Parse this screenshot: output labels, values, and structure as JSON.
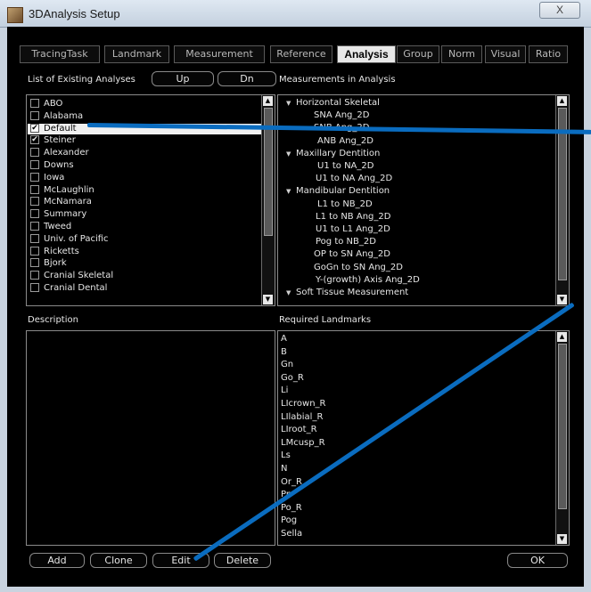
{
  "window": {
    "title": "3DAnalysis Setup",
    "close_glyph": "X"
  },
  "tabs": [
    "TracingTask",
    "Landmark",
    "Measurement",
    "Reference",
    "Analysis",
    "Group",
    "Norm",
    "Visual",
    "Ratio"
  ],
  "active_tab": "Analysis",
  "analyses": {
    "label": "List of Existing Analyses",
    "up_label": "Up",
    "dn_label": "Dn",
    "items": [
      {
        "name": "ABO",
        "checked": false
      },
      {
        "name": "Alabama",
        "checked": false
      },
      {
        "name": "Default",
        "checked": true,
        "selected": true
      },
      {
        "name": "Steiner",
        "checked": true
      },
      {
        "name": "Alexander",
        "checked": false
      },
      {
        "name": "Downs",
        "checked": false
      },
      {
        "name": "Iowa",
        "checked": false
      },
      {
        "name": "McLaughlin",
        "checked": false
      },
      {
        "name": "McNamara",
        "checked": false
      },
      {
        "name": "Summary",
        "checked": false
      },
      {
        "name": "Tweed",
        "checked": false
      },
      {
        "name": "Univ. of Pacific",
        "checked": false
      },
      {
        "name": "Ricketts",
        "checked": false
      },
      {
        "name": "Bjork",
        "checked": false
      },
      {
        "name": "Cranial Skeletal",
        "checked": false
      },
      {
        "name": "Cranial Dental",
        "checked": false
      }
    ]
  },
  "measurements": {
    "label": "Measurements in Analysis",
    "groups": [
      {
        "name": "Horizontal Skeletal",
        "items": [
          "SNA Ang_2D",
          "SNB Ang_2D",
          "ANB Ang_2D"
        ]
      },
      {
        "name": "Maxillary Dentition",
        "items": [
          "U1 to NA_2D",
          "U1 to NA Ang_2D"
        ]
      },
      {
        "name": "Mandibular Dentition",
        "items": [
          "L1 to NB_2D",
          "L1 to NB Ang_2D",
          "U1 to L1 Ang_2D",
          "Pog to NB_2D",
          "OP to SN Ang_2D",
          "GoGn to SN Ang_2D",
          "Y-(growth) Axis Ang_2D"
        ]
      },
      {
        "name": "Soft Tissue Measurement",
        "items": []
      }
    ]
  },
  "description": {
    "label": "Description",
    "text": ""
  },
  "landmarks": {
    "label": "Required Landmarks",
    "items": [
      "A",
      "B",
      "Gn",
      "Go_R",
      "Li",
      "LIcrown_R",
      "LIlabial_R",
      "LIroot_R",
      "LMcusp_R",
      "Ls",
      "N",
      "Or_R",
      "Pn",
      "Po_R",
      "Pog",
      "Sella"
    ]
  },
  "buttons": {
    "add": "Add",
    "clone": "Clone",
    "edit": "Edit",
    "delete": "Delete",
    "ok": "OK"
  },
  "colors": {
    "annotation_line": "#0a6cbf",
    "selected_row": "#f0f0f0"
  }
}
